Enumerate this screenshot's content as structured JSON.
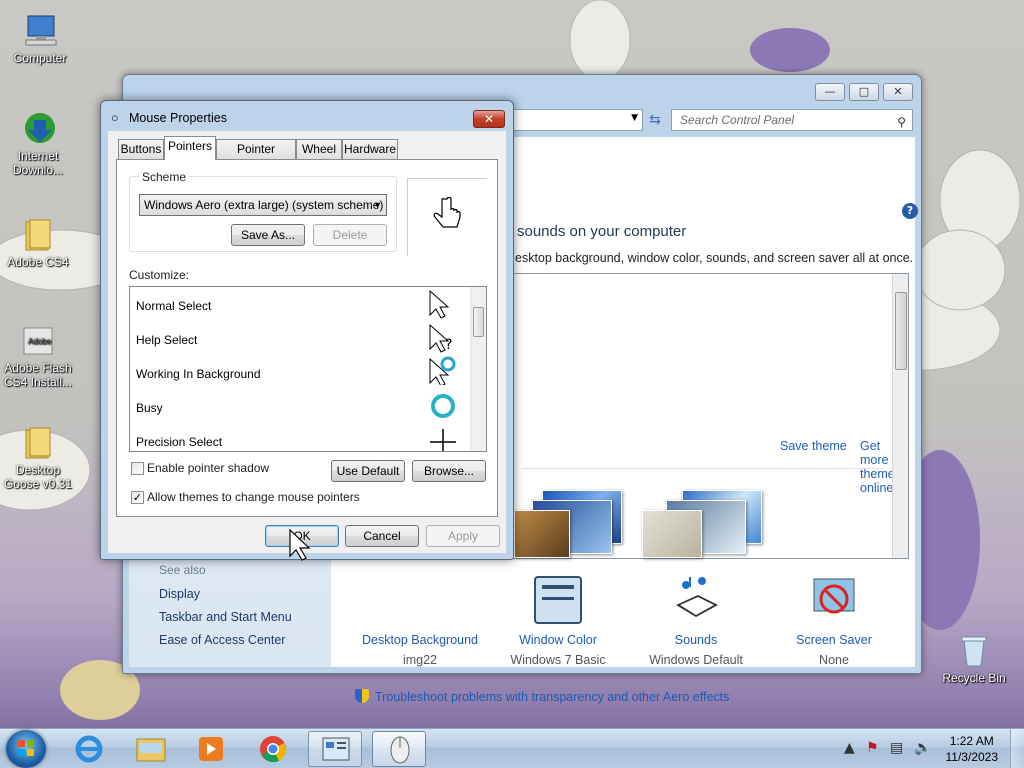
{
  "desktop": {
    "icons": [
      {
        "label": "Computer"
      },
      {
        "label": "Internet\nDownlo..."
      },
      {
        "label": "Adobe CS4"
      },
      {
        "label": "Adobe Flash\nCS4 Install..."
      },
      {
        "label": "Desktop\nGoose v0.31"
      }
    ],
    "recycle_bin": "Recycle Bin"
  },
  "control_panel": {
    "search_placeholder": "Search Control Panel",
    "heading": "sounds on your computer",
    "subheading": "esktop background, window color, sounds, and screen saver all at once.",
    "save_theme": "Save theme",
    "get_more": "Get more themes online",
    "see_also": "See also",
    "see_also_links": [
      "Display",
      "Taskbar and Start Menu",
      "Ease of Access Center"
    ],
    "bottom_items": [
      {
        "title": "Desktop Background",
        "value": "img22"
      },
      {
        "title": "Window Color",
        "value": "Windows 7 Basic"
      },
      {
        "title": "Sounds",
        "value": "Windows Default"
      },
      {
        "title": "Screen Saver",
        "value": "None"
      }
    ],
    "troubleshoot": "Troubleshoot problems with transparency and other Aero effects"
  },
  "mouse_dialog": {
    "title": "Mouse Properties",
    "tabs": [
      "Buttons",
      "Pointers",
      "Pointer Options",
      "Wheel",
      "Hardware"
    ],
    "active_tab": "Pointers",
    "scheme_label": "Scheme",
    "scheme_value": "Windows Aero (extra large) (system scheme)",
    "save_as": "Save As...",
    "delete": "Delete",
    "customize_label": "Customize:",
    "cursors": [
      "Normal Select",
      "Help Select",
      "Working In Background",
      "Busy",
      "Precision Select"
    ],
    "enable_shadow": "Enable pointer shadow",
    "enable_shadow_checked": false,
    "allow_themes": "Allow themes to change mouse pointers",
    "allow_themes_checked": true,
    "use_default": "Use Default",
    "browse": "Browse...",
    "ok": "OK",
    "cancel": "Cancel",
    "apply": "Apply"
  },
  "taskbar": {
    "time": "1:22 AM",
    "date": "11/3/2023"
  }
}
